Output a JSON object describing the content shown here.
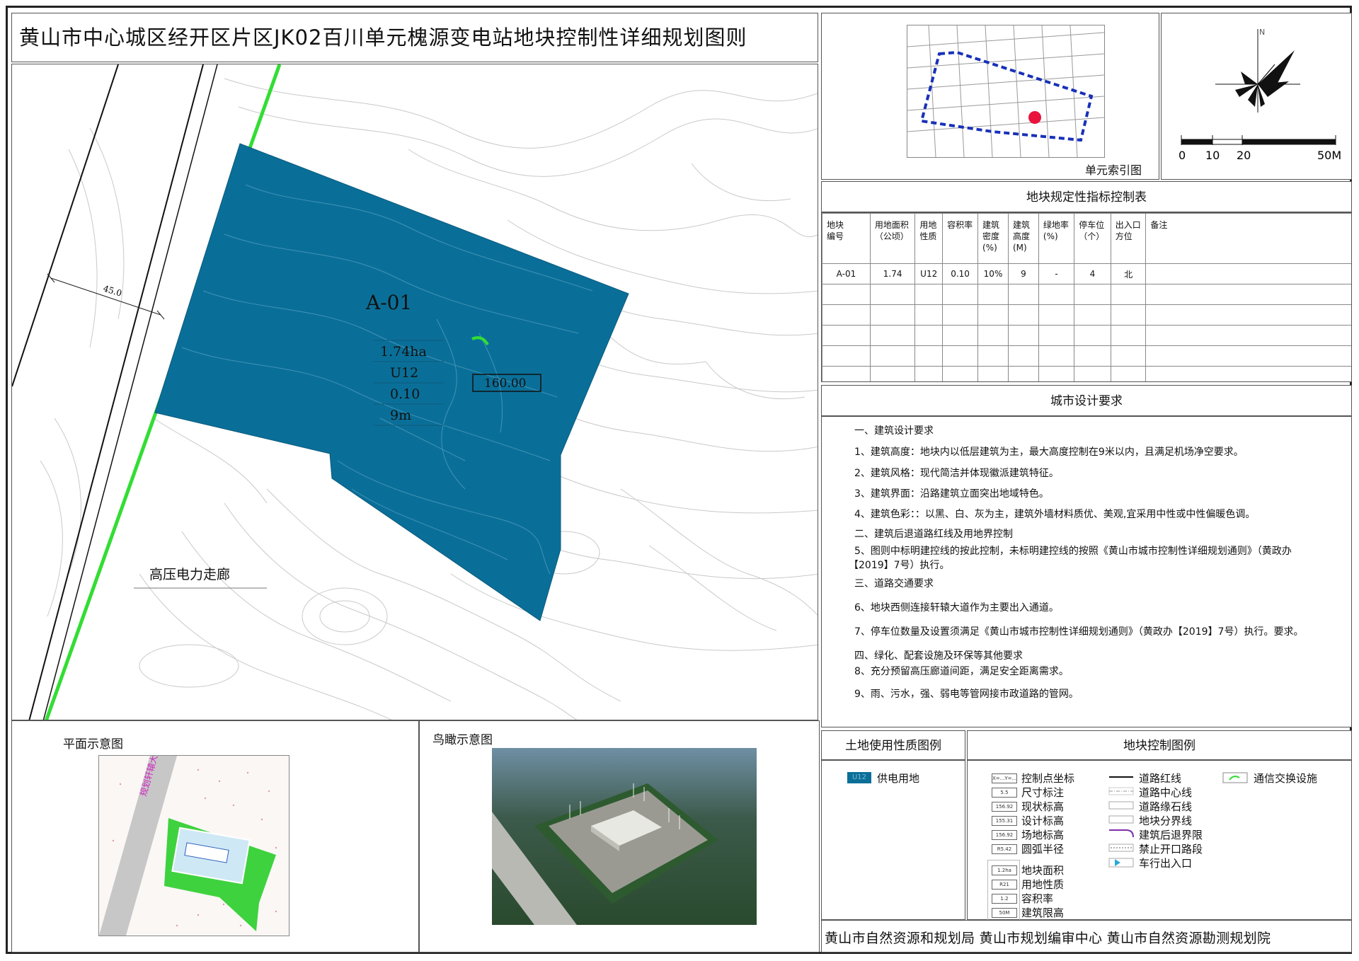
{
  "title": "黄山市中心城区经开区片区JK02百川单元槐源变电站地块控制性详细规划图则",
  "map": {
    "parcel_id": "A-01",
    "area": "1.74ha",
    "use": "U12",
    "far": "0.10",
    "height": "9m",
    "elevation": "160.00",
    "setback_dim": "45.0",
    "corridor_label": "高压电力走廊",
    "parcel_color": "#0a6f98",
    "road_color": "#33dd33"
  },
  "index_map": {
    "caption": "单元索引图"
  },
  "scale_bar": {
    "north": "N",
    "ticks": [
      "0",
      "10",
      "20",
      "50M"
    ]
  },
  "control_table": {
    "title": "地块规定性指标控制表",
    "headers": [
      [
        "地块",
        "编号"
      ],
      [
        "用地面积",
        "（公顷）"
      ],
      [
        "用地",
        "性质"
      ],
      [
        "容积率"
      ],
      [
        "建筑",
        "密度",
        "(%)"
      ],
      [
        "建筑",
        "高度",
        "(M)"
      ],
      [
        "绿地率",
        "(%)"
      ],
      [
        "停车位",
        "（个）"
      ],
      [
        "出入口",
        "方位"
      ],
      [
        "备注"
      ]
    ],
    "rows": [
      [
        "A-01",
        "1.74",
        "U12",
        "0.10",
        "10%",
        "9",
        "-",
        "4",
        "北",
        ""
      ]
    ]
  },
  "design": {
    "title": "城市设计要求",
    "lines": [
      "一、建筑设计要求",
      "1、建筑高度：地块内以低层建筑为主，最大高度控制在9米以内，且满足机场净空要求。",
      "2、建筑风格：现代简洁并体现徽派建筑特征。",
      "3、建筑界面：沿路建筑立面突出地域特色。",
      "4、建筑色彩：：以黑、白、灰为主，建筑外墙材料质优、美观,宜采用中性或中性偏暖色调。",
      "二、建筑后退道路红线及用地界控制",
      "5、图则中标明建控线的按此控制，未标明建控线的按照《黄山市城市控制性详细规划通则》（黄政办",
      "【2019】7号）执行。",
      "三、道路交通要求",
      "6、地块西侧连接轩辕大道作为主要出入通道。",
      "7、停车位数量及设置须满足《黄山市城市控制性详细规划通则》（黄政办【2019】7号）执行。要求。",
      "四、绿化、配套设施及环保等其他要求",
      "8、充分预留高压廊道间距，满足安全距离需求。",
      "9、雨、污水，强、弱电等管网接市政道路的管网。"
    ]
  },
  "land_use_legend": {
    "title": "土地使用性质图例",
    "swatch_code": "U12",
    "label": "供电用地"
  },
  "control_legend": {
    "title": "地块控制图例",
    "col1": [
      "控制点坐标",
      "尺寸标注",
      "现状标高",
      "设计标高",
      "场地标高",
      "圆弧半径"
    ],
    "col1_codes": [
      "X=...Y=...",
      "5.5",
      "156.92",
      "155.31",
      "156.92",
      "R5.42"
    ],
    "col1b": [
      "地块面积",
      "用地性质",
      "容积率",
      "建筑限高"
    ],
    "col1b_codes": [
      "1.2ha",
      "R21",
      "1.2",
      "50M"
    ],
    "col2": [
      "道路红线",
      "道路中心线",
      "道路缘石线",
      "地块分界线",
      "建筑后退界限",
      "禁止开口路段",
      "车行出入口"
    ],
    "col3": [
      "通信交换设施"
    ]
  },
  "plan_sketch": {
    "title": "平面示意图",
    "road_label": "规划轩辕大道"
  },
  "aerial": {
    "title": "鸟瞰示意图"
  },
  "footer": "黄山市自然资源和规划局  黄山市规划编审中心  黄山市自然资源勘测规划院"
}
